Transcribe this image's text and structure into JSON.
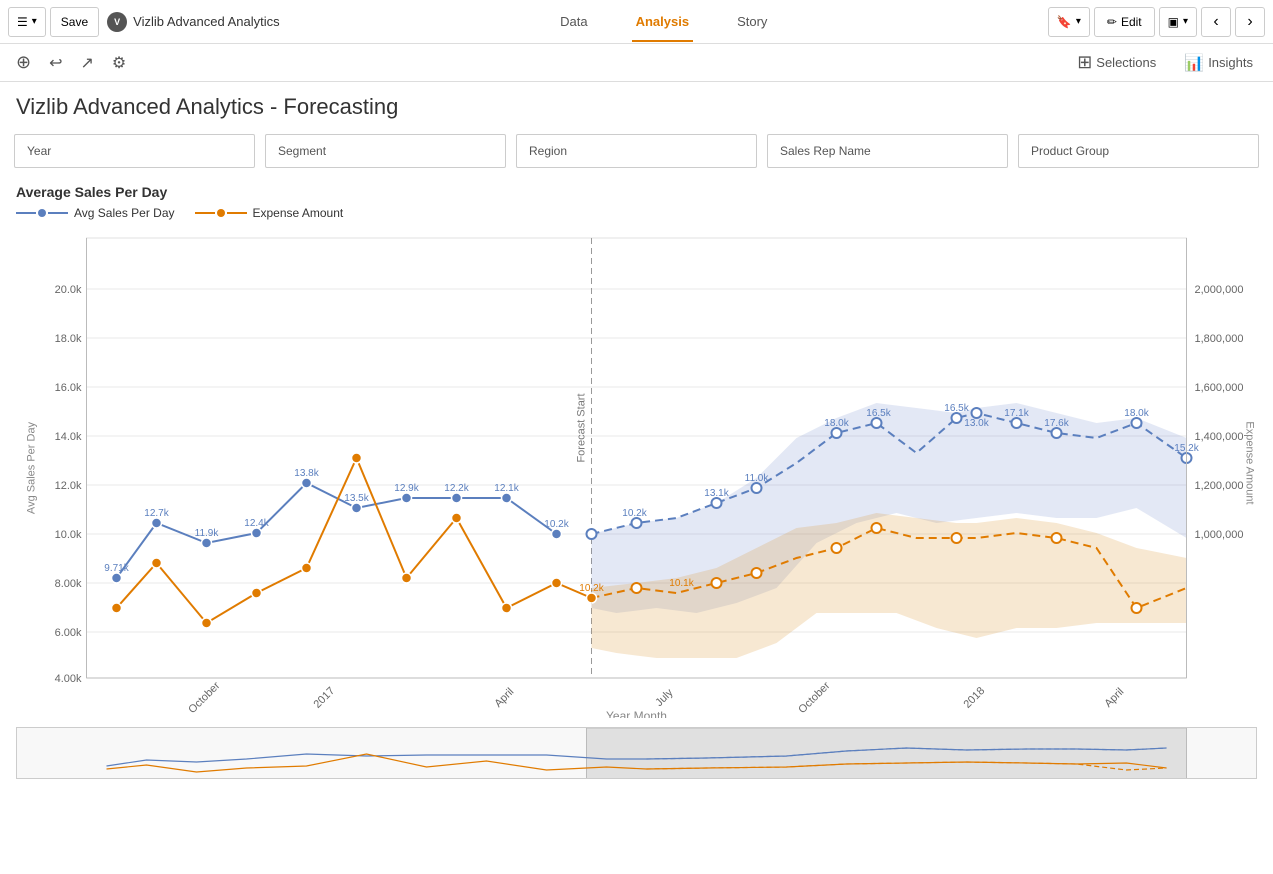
{
  "app": {
    "name": "Vizlib Advanced Analytics",
    "title": "Vizlib Advanced Analytics - Forecasting"
  },
  "toolbar": {
    "menu_label": "☰",
    "save_label": "Save",
    "data_tab": "Data",
    "analysis_tab": "Analysis",
    "story_tab": "Story",
    "edit_label": "Edit",
    "bookmark_icon": "🔖",
    "pencil_icon": "✏",
    "monitor_icon": "🖥",
    "prev_icon": "‹",
    "next_icon": "›"
  },
  "second_toolbar": {
    "zoom_icon": "⊕",
    "back_icon": "↩",
    "share_icon": "↗",
    "settings_icon": "⚙",
    "selections_label": "Selections",
    "insights_label": "Insights"
  },
  "filters": {
    "year_label": "Year",
    "segment_label": "Segment",
    "region_label": "Region",
    "sales_rep_label": "Sales Rep Name",
    "product_group_label": "Product Group"
  },
  "chart": {
    "title": "Average Sales Per Day",
    "legend": {
      "series1": "Avg Sales Per Day",
      "series2": "Expense Amount"
    },
    "x_axis_label": "Year Month",
    "y_left_label": "Avg Sales Per Day",
    "y_right_label": "Expense Amount",
    "forecast_label": "Forecast Start",
    "y_left_ticks": [
      "20.0k",
      "18.0k",
      "16.0k",
      "14.0k",
      "12.0k",
      "10.0k",
      "8.00k",
      "6.00k",
      "4.00k"
    ],
    "y_right_ticks": [
      "2,000,000",
      "1,800,000",
      "1,600,000",
      "1,400,000",
      "1,200,000",
      "1,000,000"
    ],
    "x_ticks": [
      "October",
      "2017",
      "April",
      "July",
      "October",
      "2018",
      "April"
    ],
    "data_labels": {
      "blue": [
        "9.71k",
        "12.7k",
        "11.9k",
        "12.4k",
        "13.8k",
        "13.5k",
        "12.9k",
        "12.2k",
        "12.1k",
        "10.2k",
        "10.2k",
        "13.1k",
        "11.0k",
        "18.0k",
        "16.5k",
        "16.5k",
        "13.0k",
        "17.1k",
        "17.6k",
        "18.0k",
        "15.2k"
      ],
      "orange": [
        "10.1k",
        "10.2k"
      ]
    }
  }
}
